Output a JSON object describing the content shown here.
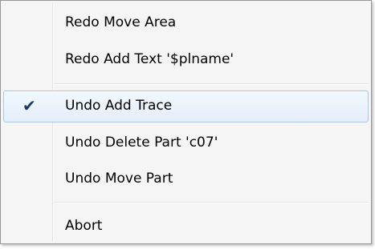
{
  "menu": {
    "items": [
      {
        "label": "Redo Move Area"
      },
      {
        "label": "Redo Add Text '$plname'"
      },
      {
        "label": "Undo Add Trace",
        "check": "✔"
      },
      {
        "label": "Undo Delete Part 'c07'"
      },
      {
        "label": "Undo Move Part"
      },
      {
        "label": "Abort"
      }
    ]
  },
  "colors": {
    "menu_background": "#f5f5f5",
    "highlight_border": "#a8c8ea",
    "check_color": "#1a3a6e"
  }
}
